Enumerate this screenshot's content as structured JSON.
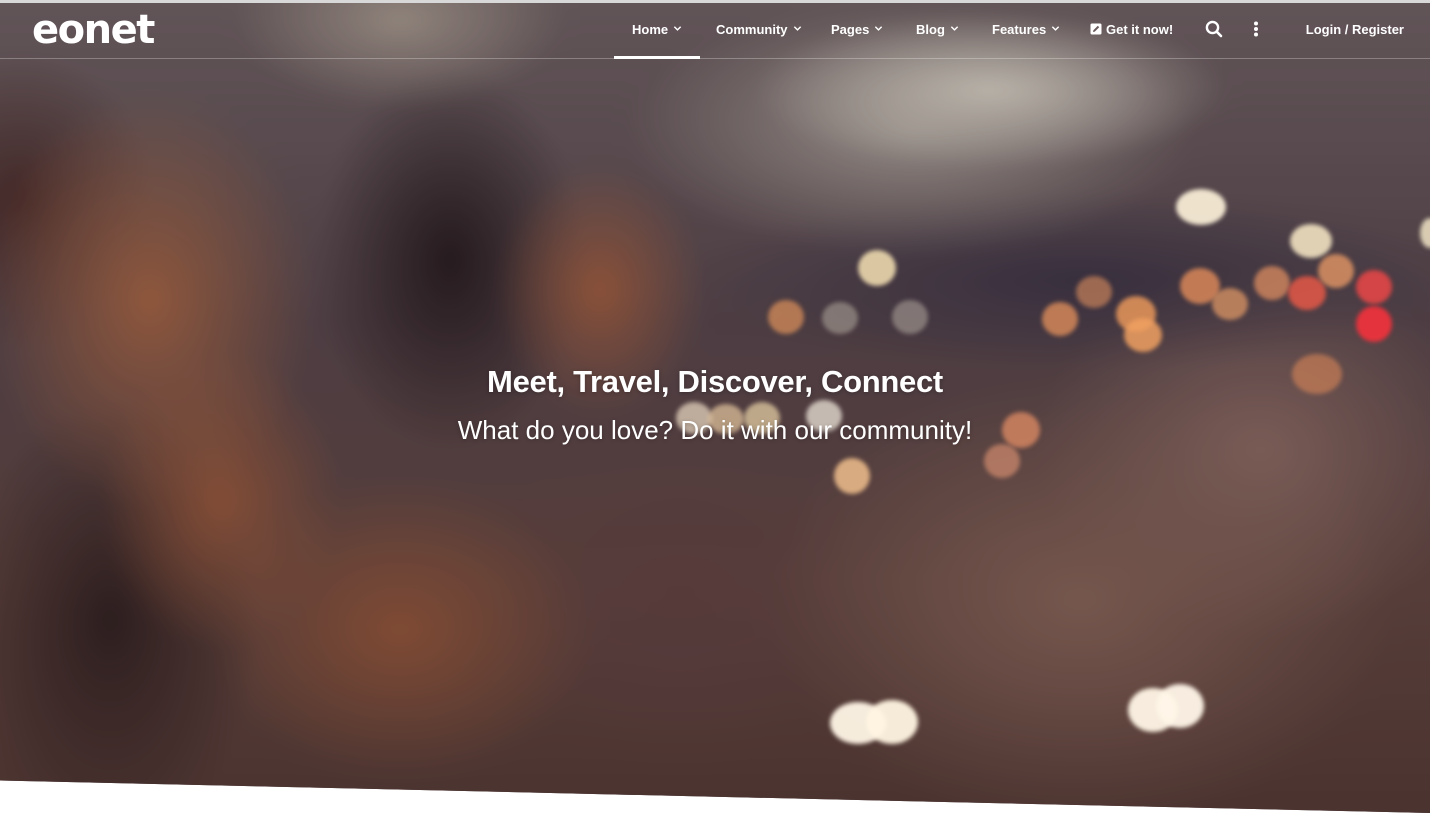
{
  "brand": {
    "logo_text": "eonet"
  },
  "nav": {
    "items": [
      {
        "label": "Home",
        "has_dropdown": true,
        "active": true
      },
      {
        "label": "Community",
        "has_dropdown": true,
        "active": false
      },
      {
        "label": "Pages",
        "has_dropdown": true,
        "active": false
      },
      {
        "label": "Blog",
        "has_dropdown": true,
        "active": false
      },
      {
        "label": "Features",
        "has_dropdown": true,
        "active": false
      }
    ],
    "cta_label": "Get it now!",
    "cta_icon": "external-edit-icon",
    "search_icon": "search-icon",
    "more_icon": "vertical-dots-icon",
    "login_label": "Login / Register"
  },
  "hero": {
    "title": "Meet, Travel, Discover, Connect",
    "subtitle": "What do you love? Do it with our community!",
    "background": "blurred photo of two women at dusk with city bokeh lights"
  },
  "colors": {
    "nav_text": "#ffffff",
    "active_underline": "#ffffff",
    "page_background": "#ffffff"
  }
}
